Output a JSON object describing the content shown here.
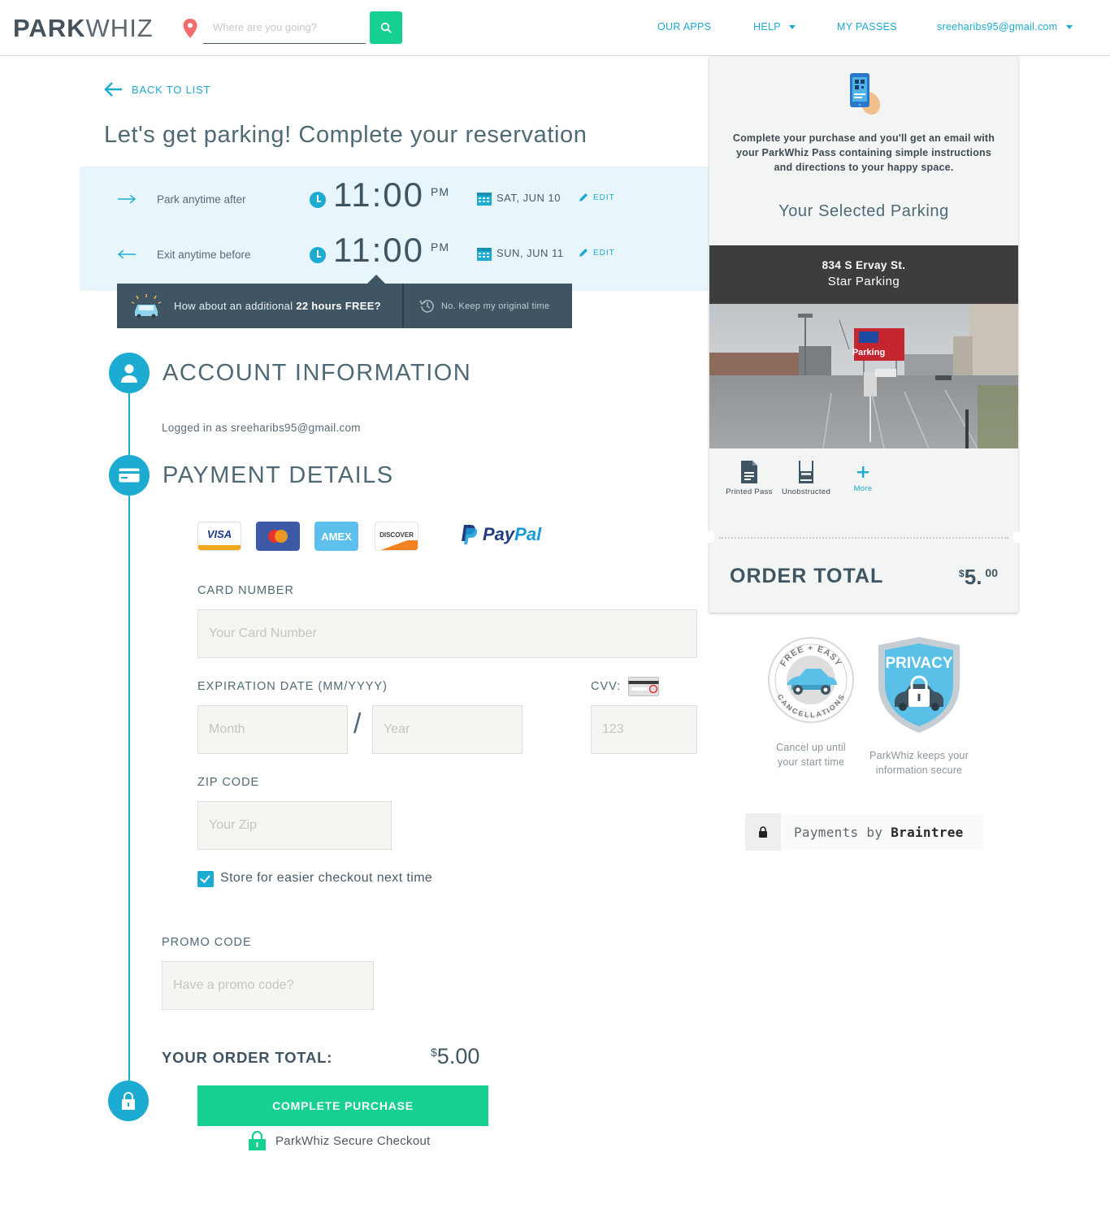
{
  "header": {
    "logo_bold": "PARK",
    "logo_light": "WHIZ",
    "search_placeholder": "Where are you going?",
    "nav": {
      "apps": "OUR APPS",
      "help": "HELP",
      "passes": "MY PASSES",
      "account": "sreeharibs95@gmail.com"
    },
    "colors": {
      "accent": "#1cabd1",
      "action": "#15d091"
    }
  },
  "main": {
    "back_label": "BACK TO LIST",
    "title": "Let's get parking! Complete your reservation",
    "park_after": {
      "label": "Park anytime after",
      "time": "11:00",
      "ampm": "PM",
      "date": "SAT, JUN 10",
      "edit": "EDIT"
    },
    "exit_before": {
      "label": "Exit anytime before",
      "time": "11:00",
      "ampm": "PM",
      "date": "SUN, JUN 11",
      "edit": "EDIT"
    },
    "upsell": {
      "text_prefix": "How about an additional",
      "text_bold": "22 hours FREE?",
      "decline": "No. Keep my original time"
    },
    "account": {
      "title": "ACCOUNT INFORMATION",
      "logged_in_prefix": "Logged in as",
      "email": "sreeharibs95@gmail.com"
    },
    "payment": {
      "title": "PAYMENT DETAILS",
      "cards": {
        "visa": "VISA",
        "amex": "AMEX",
        "discover": "DISCOVER",
        "paypal_a": "Pay",
        "paypal_b": "Pal"
      },
      "card_number_label": "CARD NUMBER",
      "card_number_placeholder": "Your Card Number",
      "expiration_label": "EXPIRATION DATE (MM/YYYY)",
      "month_placeholder": "Month",
      "year_placeholder": "Year",
      "separator": "/",
      "cvv_label": "CVV:",
      "cvv_placeholder": "123",
      "zip_label": "ZIP CODE",
      "zip_placeholder": "Your Zip",
      "store_label": "Store for easier checkout next time",
      "store_checked": true
    },
    "promo": {
      "label": "PROMO CODE",
      "placeholder": "Have a promo code?"
    },
    "order_total": {
      "label": "YOUR ORDER TOTAL:",
      "currency": "$",
      "amount": "5.00"
    },
    "complete_button": "COMPLETE PURCHASE",
    "secure_label": "ParkWhiz Secure Checkout"
  },
  "sidebar": {
    "message": "Complete your purchase and you'll get an email with your ParkWhiz Pass containing simple instructions and directions to your happy space.",
    "selected_title": "Your Selected Parking",
    "address": "834 S Ervay St.",
    "lot_name": "Star Parking",
    "sign_text": "Parking",
    "amenities": [
      {
        "icon": "printed-pass-icon",
        "label": "Printed Pass"
      },
      {
        "icon": "unobstructed-icon",
        "label": "Unobstructed"
      },
      {
        "icon": "plus-icon",
        "label": "More"
      }
    ],
    "order_total_label": "ORDER TOTAL",
    "order_total_currency": "$",
    "order_total_whole": "5.",
    "order_total_cents": "00",
    "badges": {
      "cancel_ring_top": "FREE + EASY",
      "cancel_ring_bottom": "CANCELLATIONS",
      "cancel_caption": "Cancel up until your start time",
      "privacy_text": "PRIVACY",
      "privacy_caption": "ParkWhiz keeps your information secure"
    },
    "braintree": {
      "prefix": "Payments by",
      "brand": "Braintree"
    }
  }
}
